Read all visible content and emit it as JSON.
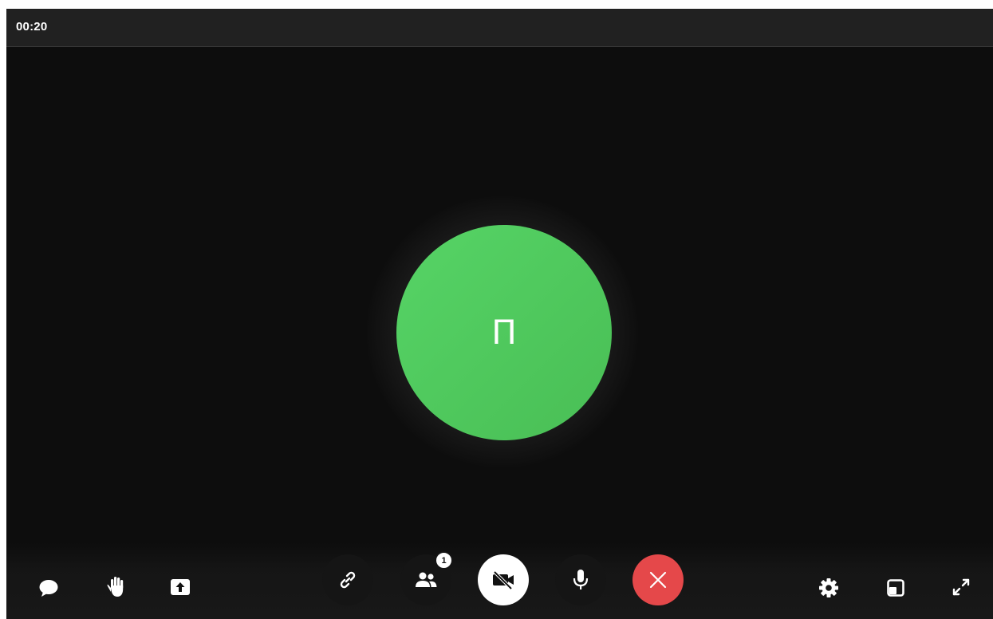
{
  "call": {
    "timer": "00:20",
    "participant_initial": "П",
    "avatar_color": "#4fc95c"
  },
  "controls": {
    "left": [
      {
        "name": "chat",
        "icon": "chat-bubble-icon"
      },
      {
        "name": "raise-hand",
        "icon": "hand-icon"
      },
      {
        "name": "share-screen",
        "icon": "screen-share-icon"
      }
    ],
    "center": [
      {
        "name": "copy-link",
        "icon": "link-icon"
      },
      {
        "name": "participants",
        "icon": "participants-icon",
        "badge": "1"
      },
      {
        "name": "camera",
        "icon": "camera-off-icon",
        "state": "off"
      },
      {
        "name": "microphone",
        "icon": "microphone-icon",
        "state": "on"
      },
      {
        "name": "end-call",
        "icon": "close-icon",
        "color": "#e5484a"
      }
    ],
    "right": [
      {
        "name": "settings",
        "icon": "gear-icon"
      },
      {
        "name": "pip",
        "icon": "picture-in-picture-icon"
      },
      {
        "name": "fullscreen",
        "icon": "expand-icon"
      }
    ]
  }
}
